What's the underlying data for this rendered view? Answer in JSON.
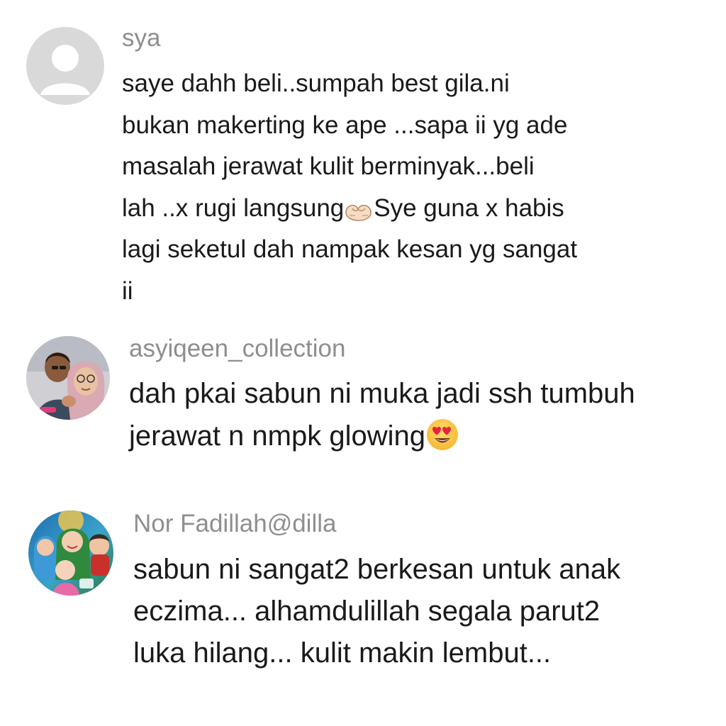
{
  "comments": [
    {
      "username": "sya",
      "avatar": "default-avatar-icon",
      "lines": [
        "saye dahh beli..sumpah best gila.ni",
        "bukan makerting ke ape ...sapa ii yg ade",
        "masalah jerawat kulit berminyak...beli"
      ],
      "line4_before_emoji": "lah ..x rugi langsung",
      "line4_emoji": "heart-hands-icon",
      "line4_after_emoji": "Sye guna x habis",
      "line5": "lagi seketul dah nampak kesan yg sangat",
      "line6": "ii"
    },
    {
      "username": "asyiqeen_collection",
      "avatar": "couple-photo-avatar",
      "lines": [
        "dah pkai sabun ni muka jadi ssh tumbuh"
      ],
      "line2_before_emoji": "jerawat n nmpk glowing",
      "line2_emoji": "heart-eyes-emoji-icon"
    },
    {
      "username": "Nor Fadillah@dilla",
      "avatar": "family-cartoon-avatar",
      "lines": [
        "sabun ni sangat2 berkesan untuk anak",
        "eczima... alhamdulillah segala parut2",
        "luka hilang... kulit makin lembut..."
      ]
    }
  ],
  "colors": {
    "username": "#8e8e8e",
    "text": "#1a1a1a",
    "background": "#ffffff",
    "default_avatar_bg": "#d9d9d9"
  }
}
